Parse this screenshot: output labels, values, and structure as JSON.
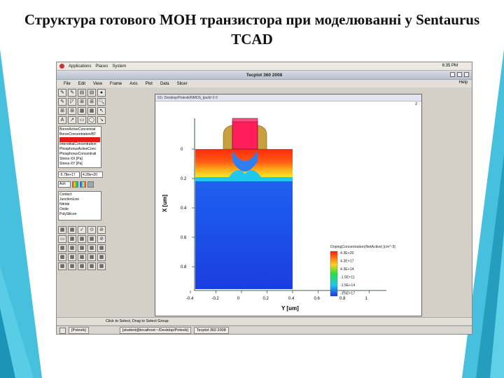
{
  "slide": {
    "title": "Структура готового МОН транзистора при моделюванні у Sentaurus TCAD"
  },
  "desktop": {
    "menus": [
      "Applications",
      "Places",
      "System"
    ],
    "clock": "6:35 PM"
  },
  "window": {
    "title": "Tecplot 360 2008",
    "menubar": [
      "File",
      "Edit",
      "View",
      "Frame",
      "Axis",
      "Plot",
      "Data",
      "Slicer"
    ],
    "help": "Help"
  },
  "toolbar": {
    "tools_row1": [
      "✎",
      "✎",
      "▤",
      "▤",
      "●"
    ],
    "tools_row2": [
      "✎",
      "◸",
      "⊞",
      "⊞",
      "🔍"
    ],
    "tools_row3": [
      "⊞",
      "⊞",
      "▦",
      "▦",
      "↖"
    ],
    "tools_row4": [
      "A",
      "↗",
      "▭",
      "◯",
      "↘"
    ],
    "variables": [
      "BoronActiveConcentrat",
      "BoronConcentration/BT",
      "DopingConcentration",
      "InterstitialConcentration",
      "PhosphorusActiveConc",
      "PhosphorusConcentrati",
      "Stress-XX [Pa]",
      "Stress-XY [Pa]"
    ],
    "selected_variable_index": 2,
    "min_value": "-5.78e+17",
    "max_value": "4.28e+20",
    "colormap": "Ash",
    "regions": [
      "Contact",
      "JunctionLine",
      "Nitride",
      "Oxide",
      "PolySilicon"
    ],
    "bottom_tools": [
      "▦",
      "▦",
      "✓",
      "⊙",
      "⊘",
      "▭",
      "▦",
      "▦",
      "▦",
      "⊘",
      "▦",
      "▦",
      "▦",
      "▦",
      "▦",
      "▦",
      "▦",
      "▦",
      "▦",
      "▦",
      "▦",
      "▦",
      "▦",
      "▦",
      "▦"
    ]
  },
  "frame": {
    "header": "01\\: Desktop/Polevik/NMOS_tps/dr 0 0",
    "badge": "2"
  },
  "plot": {
    "x_label": "Y [um]",
    "y_label": "X [um]",
    "x_ticks": [
      "-0.4",
      "-0.2",
      "0",
      "0.2",
      "0.4",
      "0.6",
      "0.8",
      "1"
    ],
    "y_ticks": [
      "0",
      "0.2",
      "0.4",
      "0.6",
      "0.8"
    ],
    "legend_title": "DopingConcentration(NetActive) [cm^-3]",
    "legend_labels": [
      "4.3E+20",
      "4.3E+17",
      "4.3E+14",
      "-1.5E+11",
      "-1.5E+14",
      "-1.5E+17"
    ],
    "colors": {
      "substrate": "#1a4fe0",
      "junction": "#1ec3f0",
      "drain": "#ff3010",
      "gate_poly": "#ff1e5a",
      "spacer": "#c9a040",
      "axis": "#003300"
    }
  },
  "status": {
    "hint": "Click to Select, Drag to Select Group"
  },
  "taskbar": {
    "items": [
      "[Polevik]",
      "[student@localhost:~/Desktop/Polevik]",
      "Tecplot 360 2008"
    ]
  }
}
